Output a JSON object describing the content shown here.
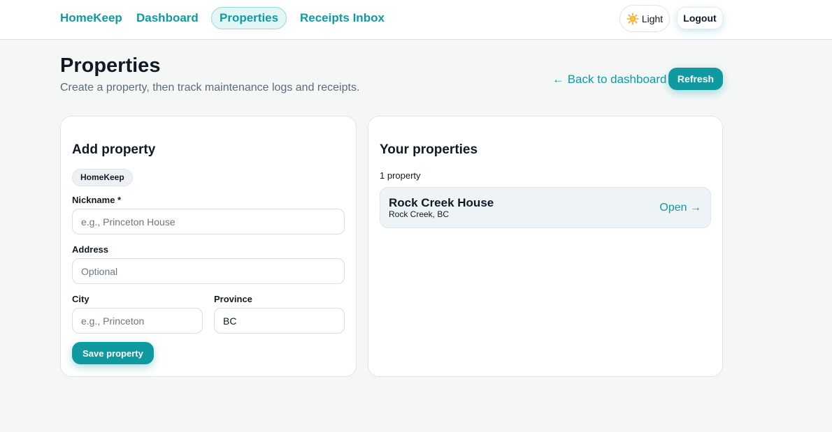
{
  "nav": {
    "brand": "HomeKeep",
    "links": [
      {
        "label": "Dashboard"
      },
      {
        "label": "Properties",
        "active": true
      },
      {
        "label": "Receipts Inbox"
      }
    ],
    "theme_label": "Light",
    "logout_label": "Logout"
  },
  "header": {
    "title": "Properties",
    "subtitle": "Create a property, then track maintenance logs and receipts.",
    "back_label": "← Back to dashboard",
    "refresh_label": "Refresh"
  },
  "add_property": {
    "title": "Add property",
    "chip": "HomeKeep",
    "nickname": {
      "label": "Nickname *",
      "value": "",
      "placeholder": "e.g., Princeton House"
    },
    "address": {
      "label": "Address",
      "value": "",
      "placeholder": "Optional"
    },
    "city": {
      "label": "City",
      "value": "",
      "placeholder": "e.g., Princeton"
    },
    "province": {
      "label": "Province",
      "value": "BC",
      "placeholder": ""
    },
    "save_label": "Save property"
  },
  "properties": {
    "title": "Your properties",
    "count_text": "1 property",
    "items": [
      {
        "name": "Rock Creek House",
        "location": "Rock Creek, BC",
        "open_label": "Open →"
      }
    ]
  },
  "colors": {
    "accent": "#0e9aa0",
    "background": "#f5f7f7",
    "card": "#ffffff"
  },
  "icons": {
    "theme": "sun-icon"
  }
}
